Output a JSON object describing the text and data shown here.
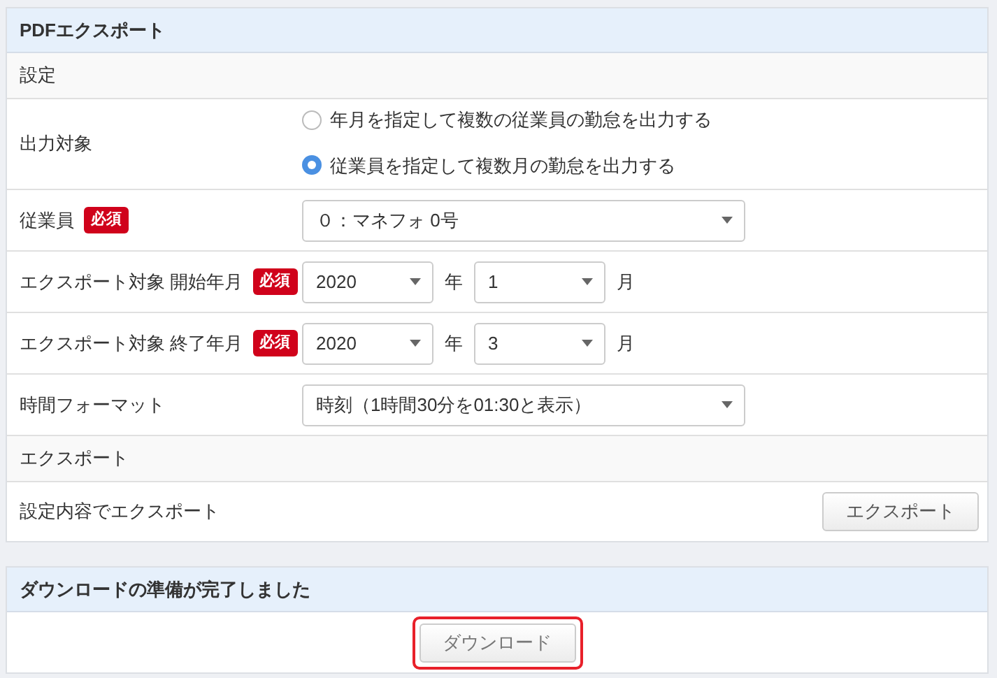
{
  "panel": {
    "title": "PDFエクスポート",
    "sections": [
      {
        "heading": "設定",
        "rows": [
          {
            "kind": "radio",
            "label": "出力対象",
            "options": [
              {
                "label": "年月を指定して複数の従業員の勤怠を出力する",
                "selected": false
              },
              {
                "label": "従業員を指定して複数月の勤怠を出力する",
                "selected": true
              }
            ]
          },
          {
            "kind": "select",
            "label": "従業員",
            "required": "必須",
            "value": "０：マネフォ 0号"
          },
          {
            "kind": "yearmonth",
            "label": "エクスポート対象 開始年月",
            "required": "必須",
            "year": "2020",
            "year_unit": "年",
            "month": "1",
            "month_unit": "月"
          },
          {
            "kind": "yearmonth",
            "label": "エクスポート対象 終了年月",
            "required": "必須",
            "year": "2020",
            "year_unit": "年",
            "month": "3",
            "month_unit": "月"
          },
          {
            "kind": "select",
            "label": "時間フォーマット",
            "value": "時刻（1時間30分を01:30と表示）"
          }
        ]
      },
      {
        "heading": "エクスポート",
        "rows": [
          {
            "kind": "button",
            "label": "設定内容でエクスポート",
            "button": "エクスポート"
          }
        ]
      }
    ]
  },
  "download_panel": {
    "title": "ダウンロードの準備が完了しました",
    "button": {
      "label": "ダウンロード",
      "highlighted": true
    }
  }
}
